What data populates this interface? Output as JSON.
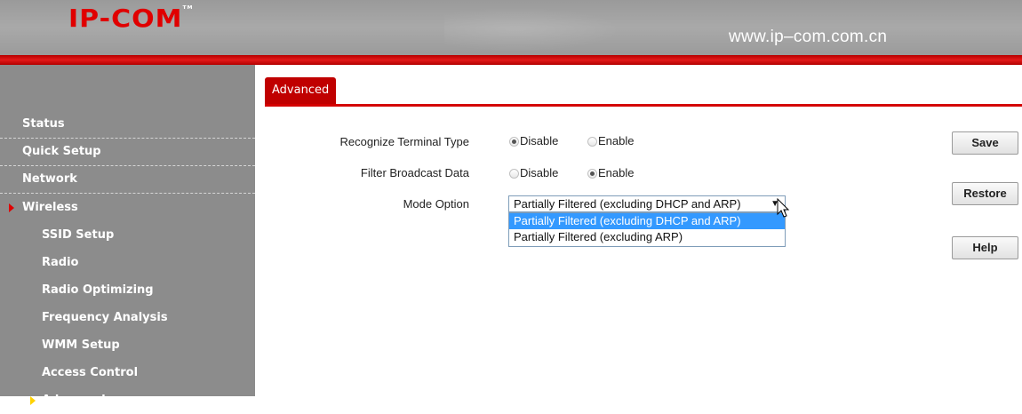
{
  "header": {
    "logo": "IP-COM",
    "logo_tm": "TM",
    "url": "www.ip–com.com.cn"
  },
  "sidebar": {
    "items": [
      {
        "label": "Status",
        "level": "top"
      },
      {
        "label": "Quick Setup",
        "level": "top"
      },
      {
        "label": "Network",
        "level": "top"
      },
      {
        "label": "Wireless",
        "level": "top",
        "expanded": true
      },
      {
        "label": "SSID Setup",
        "level": "sub"
      },
      {
        "label": "Radio",
        "level": "sub"
      },
      {
        "label": "Radio Optimizing",
        "level": "sub"
      },
      {
        "label": "Frequency Analysis",
        "level": "sub"
      },
      {
        "label": "WMM Setup",
        "level": "sub"
      },
      {
        "label": "Access Control",
        "level": "sub"
      },
      {
        "label": "Advanced",
        "level": "sub",
        "active": true
      }
    ]
  },
  "tabs": [
    {
      "label": "Advanced",
      "active": true
    }
  ],
  "form": {
    "recognize": {
      "label": "Recognize Terminal Type",
      "options": [
        "Disable",
        "Enable"
      ],
      "selected": "Disable"
    },
    "filter": {
      "label": "Filter Broadcast Data",
      "options": [
        "Disable",
        "Enable"
      ],
      "selected": "Enable"
    },
    "mode": {
      "label": "Mode Option",
      "value": "Partially Filtered (excluding DHCP and ARP)",
      "options": [
        "Partially Filtered (excluding DHCP and ARP)",
        "Partially Filtered (excluding ARP)"
      ],
      "highlighted": 0
    }
  },
  "buttons": {
    "save": "Save",
    "restore": "Restore",
    "help": "Help"
  },
  "colors": {
    "accent": "#d40000",
    "sidebar": "#8c8c8c",
    "selection": "#3399ff"
  }
}
